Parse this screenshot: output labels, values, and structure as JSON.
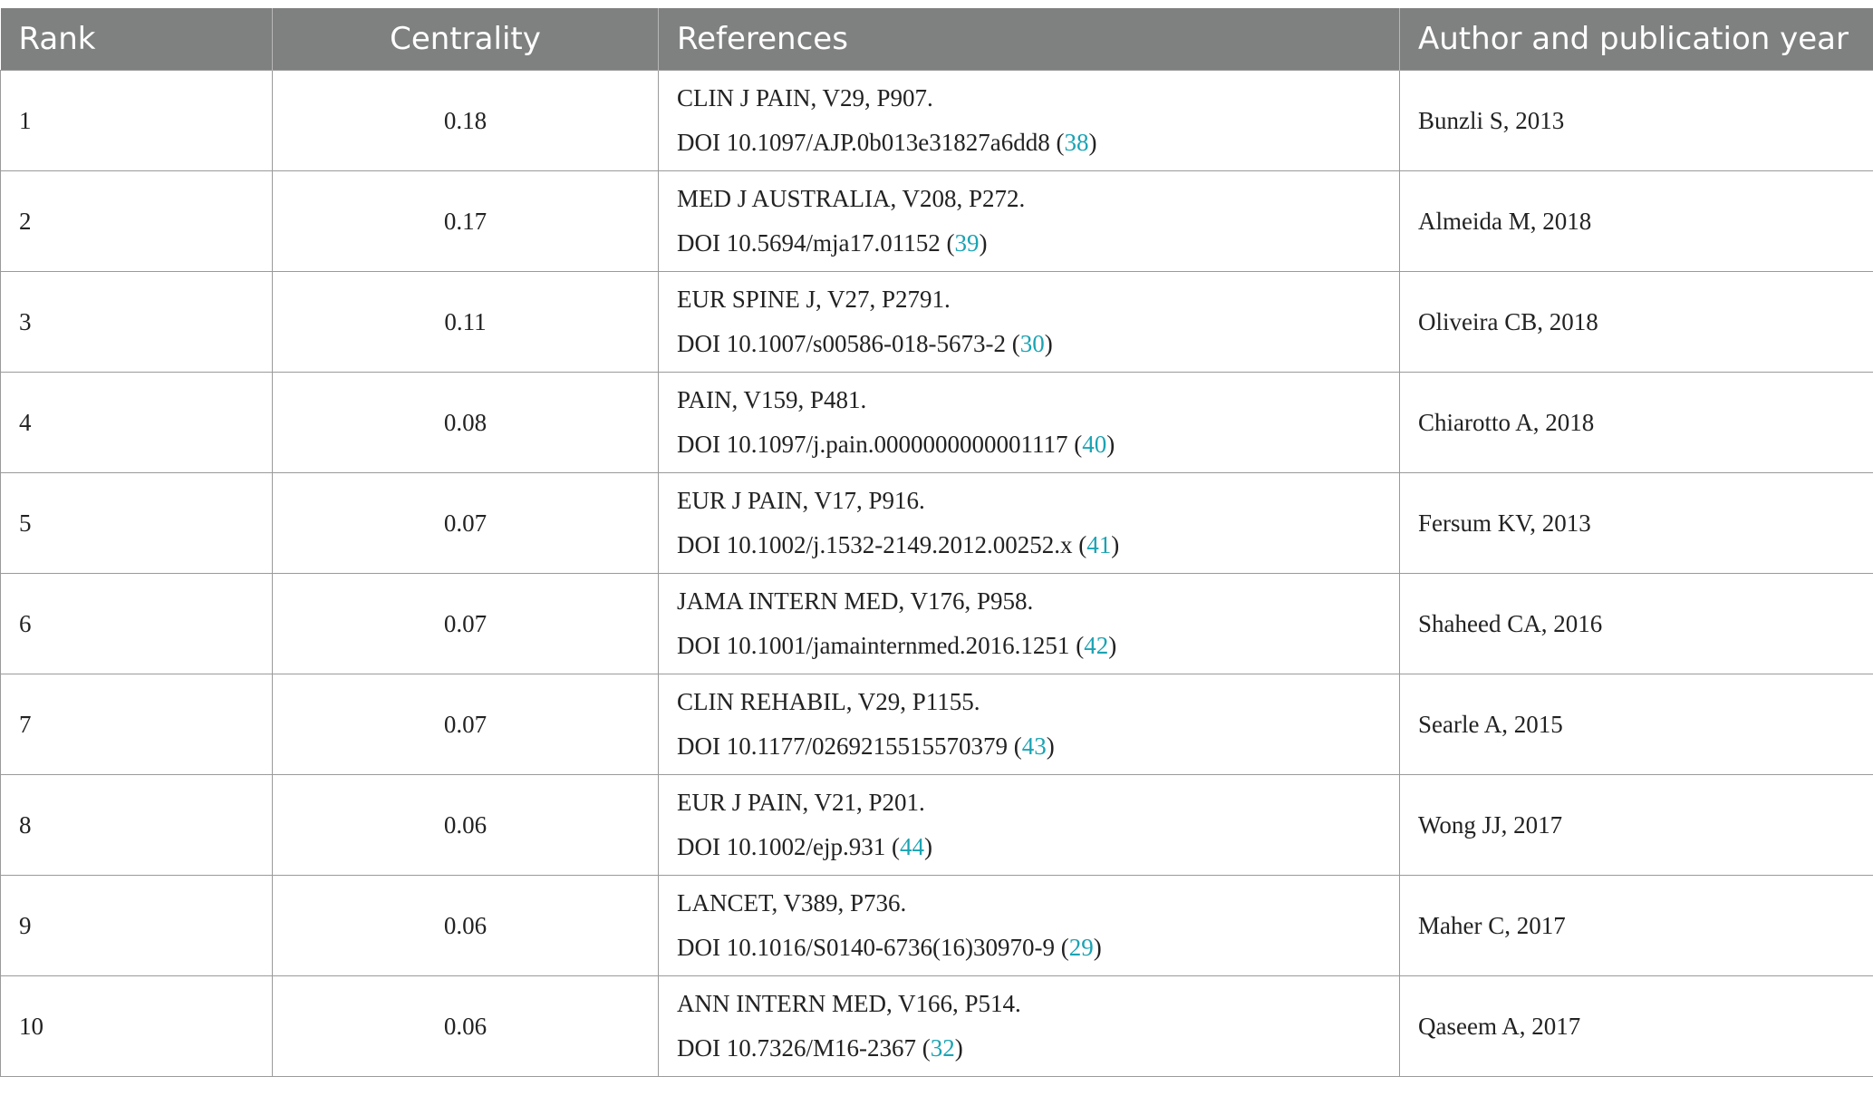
{
  "table": {
    "columns": [
      "Rank",
      "Centrality",
      "References",
      "Author and publication year"
    ],
    "rows": [
      {
        "rank": "1",
        "centrality": "0.18",
        "ref_line1": "CLIN J PAIN, V29, P907.",
        "ref_doi": "DOI 10.1097/AJP.0b013e31827a6dd8",
        "ref_cite": "38",
        "author": "Bunzli S, 2013"
      },
      {
        "rank": "2",
        "centrality": "0.17",
        "ref_line1": "MED J AUSTRALIA, V208, P272.",
        "ref_doi": "DOI 10.5694/mja17.01152",
        "ref_cite": "39",
        "author": "Almeida M, 2018"
      },
      {
        "rank": "3",
        "centrality": "0.11",
        "ref_line1": "EUR SPINE J, V27, P2791.",
        "ref_doi": "DOI 10.1007/s00586-018-5673-2",
        "ref_cite": "30",
        "author": "Oliveira CB, 2018"
      },
      {
        "rank": "4",
        "centrality": "0.08",
        "ref_line1": "PAIN, V159, P481.",
        "ref_doi": "DOI 10.1097/j.pain.0000000000001117",
        "ref_cite": "40",
        "author": "Chiarotto A, 2018"
      },
      {
        "rank": "5",
        "centrality": "0.07",
        "ref_line1": "EUR J PAIN, V17, P916.",
        "ref_doi": "DOI 10.1002/j.1532-2149.2012.00252.x",
        "ref_cite": "41",
        "author": "Fersum KV, 2013"
      },
      {
        "rank": "6",
        "centrality": "0.07",
        "ref_line1": "JAMA INTERN MED, V176, P958.",
        "ref_doi": "DOI 10.1001/jamainternmed.2016.1251",
        "ref_cite": "42",
        "author": "Shaheed CA, 2016"
      },
      {
        "rank": "7",
        "centrality": "0.07",
        "ref_line1": "CLIN REHABIL, V29, P1155.",
        "ref_doi": "DOI 10.1177/0269215515570379",
        "ref_cite": "43",
        "author": "Searle A, 2015"
      },
      {
        "rank": "8",
        "centrality": "0.06",
        "ref_line1": "EUR J PAIN, V21, P201.",
        "ref_doi": "DOI 10.1002/ejp.931",
        "ref_cite": "44",
        "author": "Wong JJ, 2017"
      },
      {
        "rank": "9",
        "centrality": "0.06",
        "ref_line1": "LANCET, V389, P736.",
        "ref_doi": "DOI 10.1016/S0140-6736(16)30970-9",
        "ref_cite": "29",
        "author": "Maher C, 2017"
      },
      {
        "rank": "10",
        "centrality": "0.06",
        "ref_line1": "ANN INTERN MED, V166, P514.",
        "ref_doi": "DOI 10.7326/M16-2367",
        "ref_cite": "32",
        "author": "Qaseem A, 2017"
      }
    ]
  },
  "colors": {
    "header_bg": "#7f8180",
    "header_text": "#ffffff",
    "citation_link": "#1aa3b3",
    "grid_line": "#9a9a9a"
  }
}
